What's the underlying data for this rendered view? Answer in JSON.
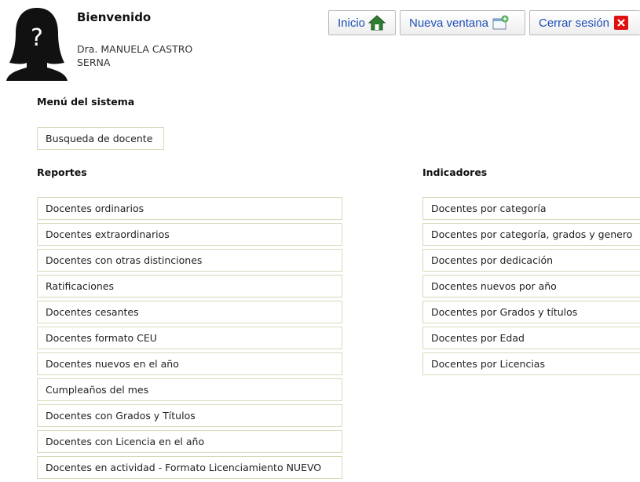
{
  "user": {
    "greeting": "Bienvenido",
    "name": "Dra. MANUELA CASTRO SERNA"
  },
  "toolbar": {
    "home_label": "Inicio",
    "new_window_label": "Nueva ventana",
    "logout_label": "Cerrar sesión",
    "home_icon": "home-icon",
    "new_window_icon": "new-window-icon",
    "logout_icon": "close-icon"
  },
  "menu": {
    "title": "Menú del sistema",
    "items": [
      "Busqueda de docente"
    ]
  },
  "reportes": {
    "title": "Reportes",
    "items": [
      "Docentes ordinarios",
      "Docentes extraordinarios",
      "Docentes con otras distinciones",
      "Ratificaciones",
      "Docentes cesantes",
      "Docentes formato CEU",
      "Docentes nuevos en el año",
      "Cumpleaños del mes",
      "Docentes con Grados y Títulos",
      "Docentes con Licencia en el año",
      "Docentes en actividad - Formato Licenciamiento NUEVO"
    ]
  },
  "indicadores": {
    "title": "Indicadores",
    "items": [
      "Docentes por categoría",
      "Docentes por categoría, grados y genero",
      "Docentes por dedicación",
      "Docentes nuevos por año",
      "Docentes por Grados y títulos",
      "Docentes por Edad",
      "Docentes por Licencias"
    ]
  },
  "colors": {
    "link_blue": "#1d50b7",
    "item_border": "#d8d8b9",
    "home_green": "#2e7d32",
    "logout_red": "#e01010"
  }
}
